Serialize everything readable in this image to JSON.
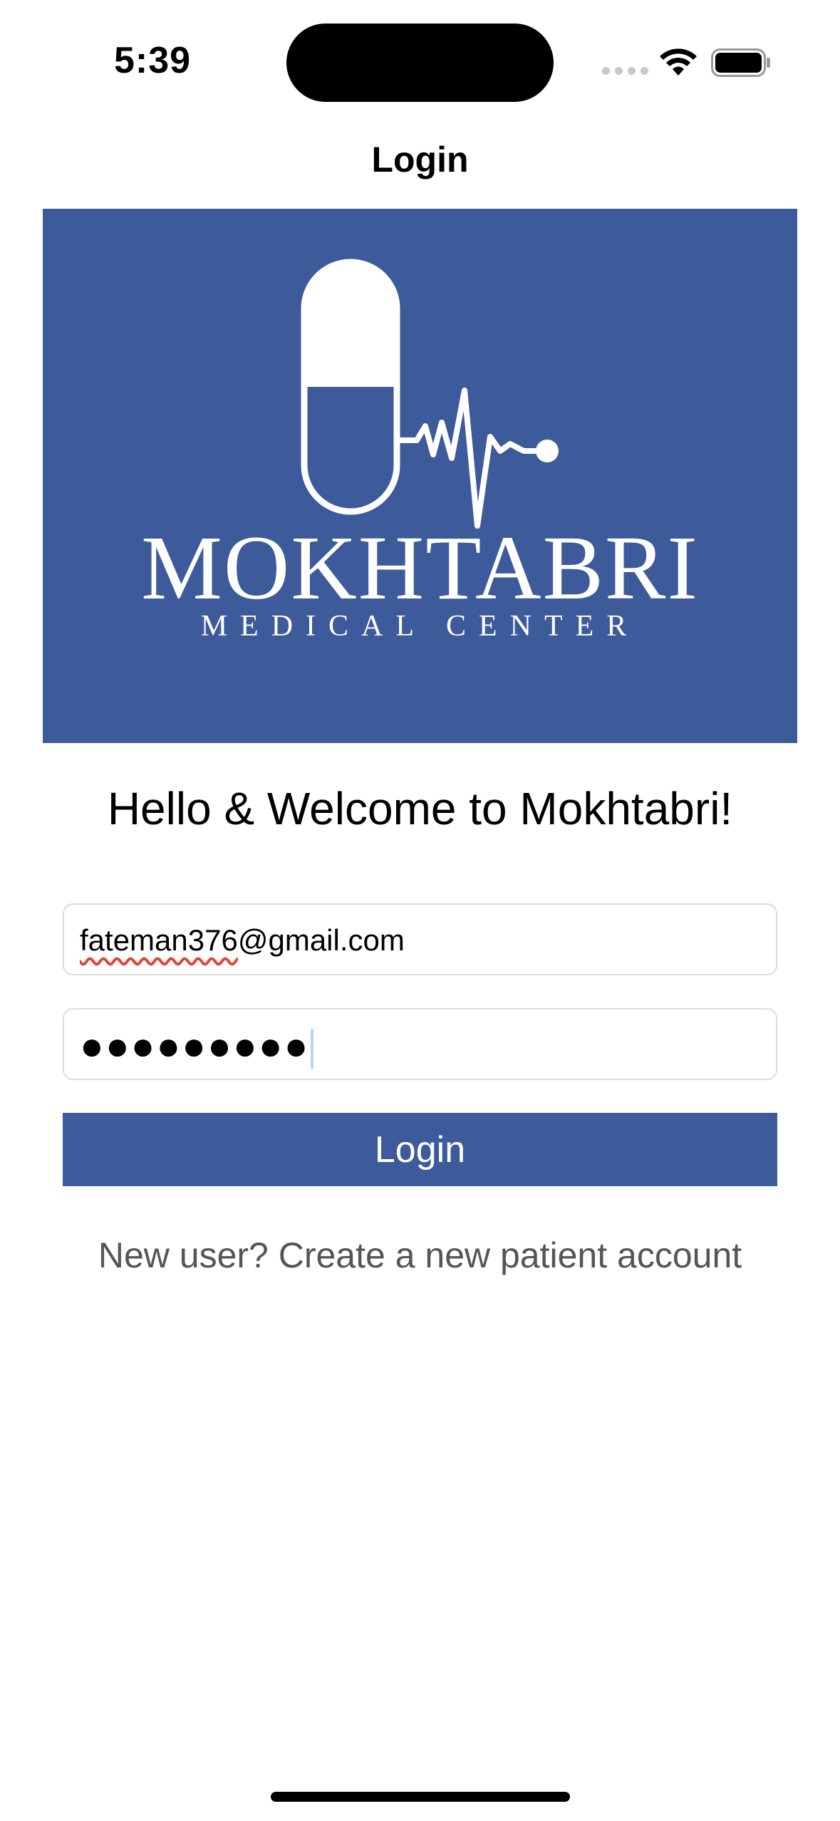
{
  "status_bar": {
    "time": "5:39",
    "icons": [
      "signal-dots-icon",
      "wifi-icon",
      "battery-icon"
    ]
  },
  "nav": {
    "title": "Login"
  },
  "logo": {
    "brand_name": "MOKHTABRI",
    "subtitle": "MEDICAL CENTER",
    "icon": "pill-heartbeat-logo-icon"
  },
  "welcome_text": "Hello & Welcome to Mokhtabri!",
  "form": {
    "email": {
      "value_underlined": "fateman376",
      "value_rest": "@gmail.com"
    },
    "password": {
      "masked_value": "●●●●●●●●●"
    },
    "login_label": "Login"
  },
  "register_text": "New user? Create a new patient account",
  "colors": {
    "brand_blue": "#3d5a9a",
    "link_gray": "#555555",
    "spellcheck_red": "#e0443a"
  }
}
